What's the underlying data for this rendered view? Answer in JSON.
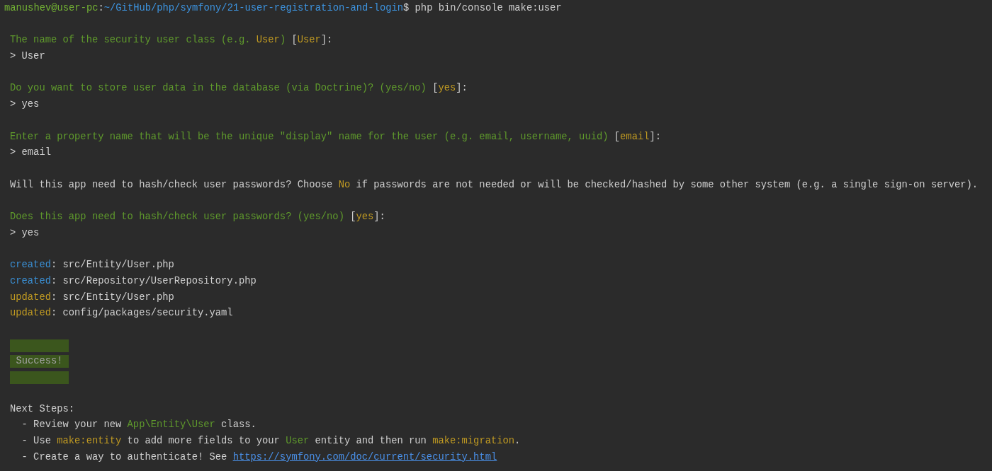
{
  "terminal": {
    "lines": [
      {
        "kind": "command",
        "segments": [
          {
            "text": "manushev@user-pc",
            "kind": "user"
          },
          {
            "text": ":",
            "kind": "plain"
          },
          {
            "text": "~/GitHub/php/symfony/21-user-registration-and-login",
            "kind": "path"
          },
          {
            "text": "$ php bin/console make:user",
            "kind": "plain"
          }
        ]
      },
      {
        "kind": "blank"
      },
      {
        "kind": "text",
        "segments": [
          {
            "text": "The name of the security user class (e.g. ",
            "kind": "question"
          },
          {
            "text": "User",
            "kind": "highlight"
          },
          {
            "text": ") ",
            "kind": "question"
          },
          {
            "text": "[",
            "kind": "plain"
          },
          {
            "text": "User",
            "kind": "highlight"
          },
          {
            "text": "]:",
            "kind": "plain"
          }
        ]
      },
      {
        "kind": "text",
        "segments": [
          {
            "text": "> User",
            "kind": "plain"
          }
        ]
      },
      {
        "kind": "blank"
      },
      {
        "kind": "text",
        "segments": [
          {
            "text": "Do you want to store user data in the database (via Doctrine)? (yes/no) ",
            "kind": "question"
          },
          {
            "text": "[",
            "kind": "plain"
          },
          {
            "text": "yes",
            "kind": "highlight"
          },
          {
            "text": "]:",
            "kind": "plain"
          }
        ]
      },
      {
        "kind": "text",
        "segments": [
          {
            "text": "> yes",
            "kind": "plain"
          }
        ]
      },
      {
        "kind": "blank"
      },
      {
        "kind": "text",
        "segments": [
          {
            "text": "Enter a property name that will be the unique \"display\" name for the user (e.g. email, username, uuid) ",
            "kind": "question"
          },
          {
            "text": "[",
            "kind": "plain"
          },
          {
            "text": "email",
            "kind": "highlight"
          },
          {
            "text": "]:",
            "kind": "plain"
          }
        ]
      },
      {
        "kind": "text",
        "segments": [
          {
            "text": "> email",
            "kind": "plain"
          }
        ]
      },
      {
        "kind": "blank"
      },
      {
        "kind": "text",
        "segments": [
          {
            "text": "Will this app need to hash/check user passwords? Choose ",
            "kind": "plain"
          },
          {
            "text": "No",
            "kind": "highlight"
          },
          {
            "text": " if passwords are not needed or will be checked/hashed by some other system (e.g. a single sign-on server).",
            "kind": "plain"
          }
        ]
      },
      {
        "kind": "blank"
      },
      {
        "kind": "text",
        "segments": [
          {
            "text": "Does this app need to hash/check user passwords? (yes/no) ",
            "kind": "question"
          },
          {
            "text": "[",
            "kind": "plain"
          },
          {
            "text": "yes",
            "kind": "highlight"
          },
          {
            "text": "]:",
            "kind": "plain"
          }
        ]
      },
      {
        "kind": "text",
        "segments": [
          {
            "text": "> yes",
            "kind": "plain"
          }
        ]
      },
      {
        "kind": "blank"
      },
      {
        "kind": "text",
        "segments": [
          {
            "text": "created",
            "kind": "created"
          },
          {
            "text": ": src/Entity/User.php",
            "kind": "plain"
          }
        ]
      },
      {
        "kind": "text",
        "segments": [
          {
            "text": "created",
            "kind": "created"
          },
          {
            "text": ": src/Repository/UserRepository.php",
            "kind": "plain"
          }
        ]
      },
      {
        "kind": "text",
        "segments": [
          {
            "text": "updated",
            "kind": "highlight"
          },
          {
            "text": ": src/Entity/User.php",
            "kind": "plain"
          }
        ]
      },
      {
        "kind": "text",
        "segments": [
          {
            "text": "updated",
            "kind": "highlight"
          },
          {
            "text": ": config/packages/security.yaml",
            "kind": "plain"
          }
        ]
      },
      {
        "kind": "blank"
      },
      {
        "kind": "banner",
        "text": "Success!"
      },
      {
        "kind": "blank"
      },
      {
        "kind": "text",
        "segments": [
          {
            "text": "Next Steps:",
            "kind": "plain"
          }
        ]
      },
      {
        "kind": "text",
        "segments": [
          {
            "text": "  - Review your new ",
            "kind": "plain"
          },
          {
            "text": "App\\Entity\\User",
            "kind": "question"
          },
          {
            "text": " class.",
            "kind": "plain"
          }
        ]
      },
      {
        "kind": "text",
        "segments": [
          {
            "text": "  - Use ",
            "kind": "plain"
          },
          {
            "text": "make:entity",
            "kind": "highlight"
          },
          {
            "text": " to add more fields to your ",
            "kind": "plain"
          },
          {
            "text": "User",
            "kind": "question"
          },
          {
            "text": " entity and then run ",
            "kind": "plain"
          },
          {
            "text": "make:migration",
            "kind": "highlight"
          },
          {
            "text": ".",
            "kind": "plain"
          }
        ]
      },
      {
        "kind": "text",
        "segments": [
          {
            "text": "  - Create a way to authenticate! See ",
            "kind": "plain"
          },
          {
            "text": "https://symfony.com/doc/current/security.html",
            "kind": "link"
          }
        ]
      }
    ]
  }
}
